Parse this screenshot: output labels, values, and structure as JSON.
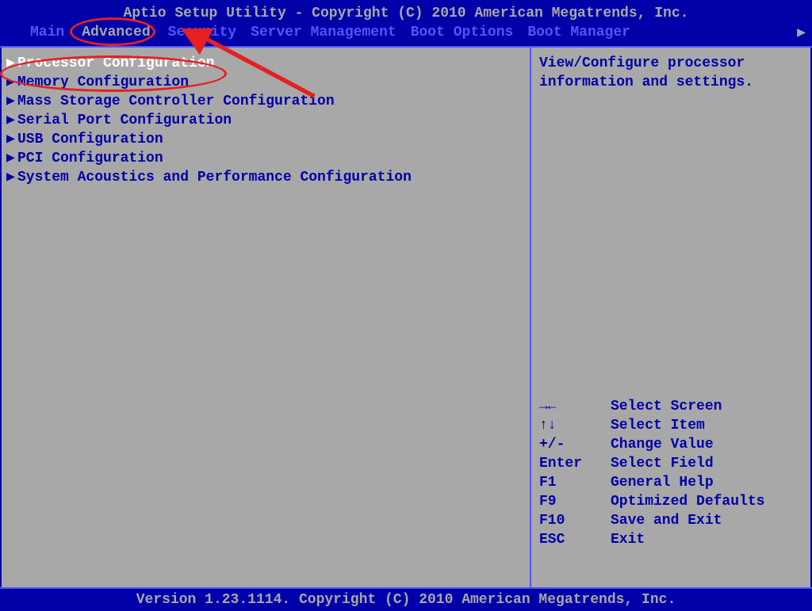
{
  "header": {
    "title": "Aptio Setup Utility - Copyright (C) 2010 American Megatrends, Inc.",
    "tabs": [
      "Main",
      "Advanced",
      "Security",
      "Server Management",
      "Boot Options",
      "Boot Manager"
    ],
    "active_tab_index": 1
  },
  "menu": {
    "items": [
      "Processor Configuration",
      "Memory Configuration",
      "Mass Storage Controller Configuration",
      "Serial Port Configuration",
      "USB Configuration",
      "PCI Configuration",
      "System Acoustics and Performance Configuration"
    ],
    "selected_index": 0
  },
  "help": {
    "text_line1": "View/Configure processor",
    "text_line2": "information and settings."
  },
  "keys": [
    {
      "key": "→←",
      "desc": "Select Screen"
    },
    {
      "key": "↑↓",
      "desc": "Select Item"
    },
    {
      "key": "+/-",
      "desc": "Change Value"
    },
    {
      "key": "Enter",
      "desc": "Select Field"
    },
    {
      "key": "F1",
      "desc": "General Help"
    },
    {
      "key": "F9",
      "desc": "Optimized Defaults"
    },
    {
      "key": "F10",
      "desc": "Save and Exit"
    },
    {
      "key": "ESC",
      "desc": "Exit"
    }
  ],
  "footer": {
    "version": "Version 1.23.1114. Copyright (C) 2010 American Megatrends, Inc."
  },
  "annotation": {
    "circled_tab": "Advanced",
    "circled_item": "Processor Configuration"
  }
}
